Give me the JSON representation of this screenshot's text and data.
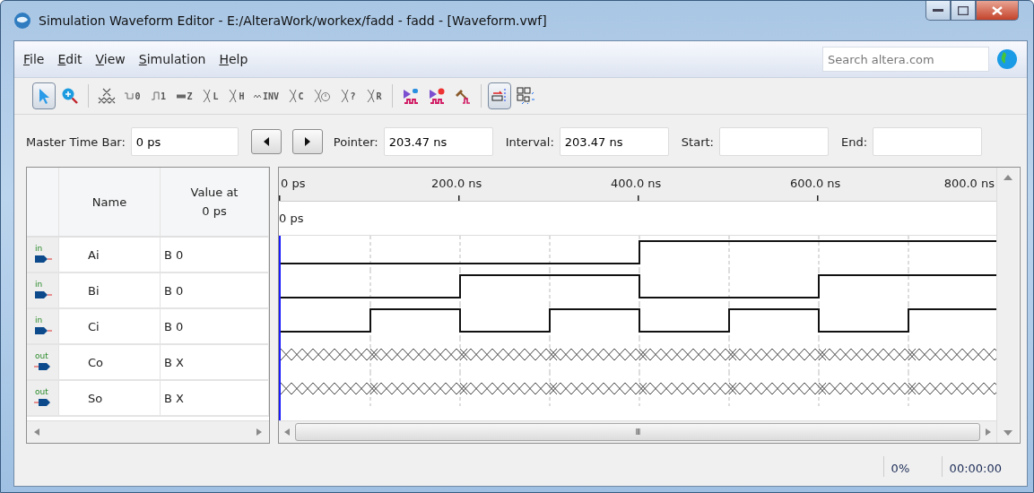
{
  "window": {
    "title": "Simulation Waveform Editor - E:/AlteraWork/workex/fadd - fadd - [Waveform.vwf]"
  },
  "menu": [
    "File",
    "Edit",
    "View",
    "Simulation",
    "Help"
  ],
  "search": {
    "placeholder": "Search altera.com"
  },
  "toolbar": [
    {
      "kind": "pointer",
      "selected": true
    },
    {
      "kind": "zoom",
      "selected": false
    },
    {
      "kind": "sep"
    },
    {
      "kind": "unknown",
      "selected": false
    },
    {
      "kind": "low",
      "label": "0",
      "selected": false
    },
    {
      "kind": "high",
      "label": "1",
      "selected": false
    },
    {
      "kind": "hiz",
      "label": "Z",
      "selected": false
    },
    {
      "kind": "letter",
      "label": "L",
      "selected": false
    },
    {
      "kind": "letter",
      "label": "H",
      "selected": false
    },
    {
      "kind": "invert",
      "label": "INV",
      "selected": false
    },
    {
      "kind": "letter",
      "label": "C",
      "selected": false
    },
    {
      "kind": "clock",
      "selected": false
    },
    {
      "kind": "letter",
      "label": "?",
      "selected": false
    },
    {
      "kind": "letter",
      "label": "R",
      "selected": false
    },
    {
      "kind": "sep"
    },
    {
      "kind": "sim",
      "selected": false
    },
    {
      "kind": "simtime",
      "selected": false
    },
    {
      "kind": "build",
      "selected": false
    },
    {
      "kind": "sep"
    },
    {
      "kind": "snap",
      "selected": true
    },
    {
      "kind": "grid",
      "selected": false
    }
  ],
  "time_bar": {
    "master_label": "Master Time Bar:",
    "master_value": "0 ps",
    "pointer_label": "Pointer:",
    "pointer_value": "203.47 ns",
    "interval_label": "Interval:",
    "interval_value": "203.47 ns",
    "start_label": "Start:",
    "end_label": "End:"
  },
  "table": {
    "name_header": "Name",
    "value_header": [
      "Value at",
      "0 ps"
    ]
  },
  "ruler": {
    "ticks": [
      "0 ps",
      "200.0 ns",
      "400.0 ns",
      "600.0 ns",
      "800.0 ns"
    ],
    "marker": "0 ps",
    "scroll_mark": "III"
  },
  "signals": [
    {
      "direction": "in",
      "name": "Ai",
      "value": "B 0",
      "segments": [
        {
          "kind": "low"
        },
        {
          "kind": "low"
        },
        {
          "kind": "low"
        },
        {
          "kind": "low"
        },
        {
          "kind": "high"
        },
        {
          "kind": "high"
        },
        {
          "kind": "high"
        },
        {
          "kind": "high"
        }
      ]
    },
    {
      "direction": "in",
      "name": "Bi",
      "value": "B 0",
      "segments": [
        {
          "kind": "low"
        },
        {
          "kind": "low"
        },
        {
          "kind": "high"
        },
        {
          "kind": "high"
        },
        {
          "kind": "low"
        },
        {
          "kind": "low"
        },
        {
          "kind": "high"
        },
        {
          "kind": "high"
        }
      ]
    },
    {
      "direction": "in",
      "name": "Ci",
      "value": "B 0",
      "segments": [
        {
          "kind": "low"
        },
        {
          "kind": "high"
        },
        {
          "kind": "low"
        },
        {
          "kind": "high"
        },
        {
          "kind": "low"
        },
        {
          "kind": "high"
        },
        {
          "kind": "low"
        },
        {
          "kind": "high"
        }
      ]
    },
    {
      "direction": "out",
      "name": "Co",
      "value": "B X",
      "segments": [
        {
          "kind": "unknown"
        },
        {
          "kind": "unknown"
        },
        {
          "kind": "unknown"
        },
        {
          "kind": "unknown"
        },
        {
          "kind": "unknown"
        },
        {
          "kind": "unknown"
        },
        {
          "kind": "unknown"
        },
        {
          "kind": "unknown"
        }
      ]
    },
    {
      "direction": "out",
      "name": "So",
      "value": "B X",
      "segments": [
        {
          "kind": "unknown"
        },
        {
          "kind": "unknown"
        },
        {
          "kind": "unknown"
        },
        {
          "kind": "unknown"
        },
        {
          "kind": "unknown"
        },
        {
          "kind": "unknown"
        },
        {
          "kind": "unknown"
        },
        {
          "kind": "unknown"
        }
      ]
    }
  ],
  "status": {
    "progress": "0%",
    "elapsed": "00:00:00"
  }
}
